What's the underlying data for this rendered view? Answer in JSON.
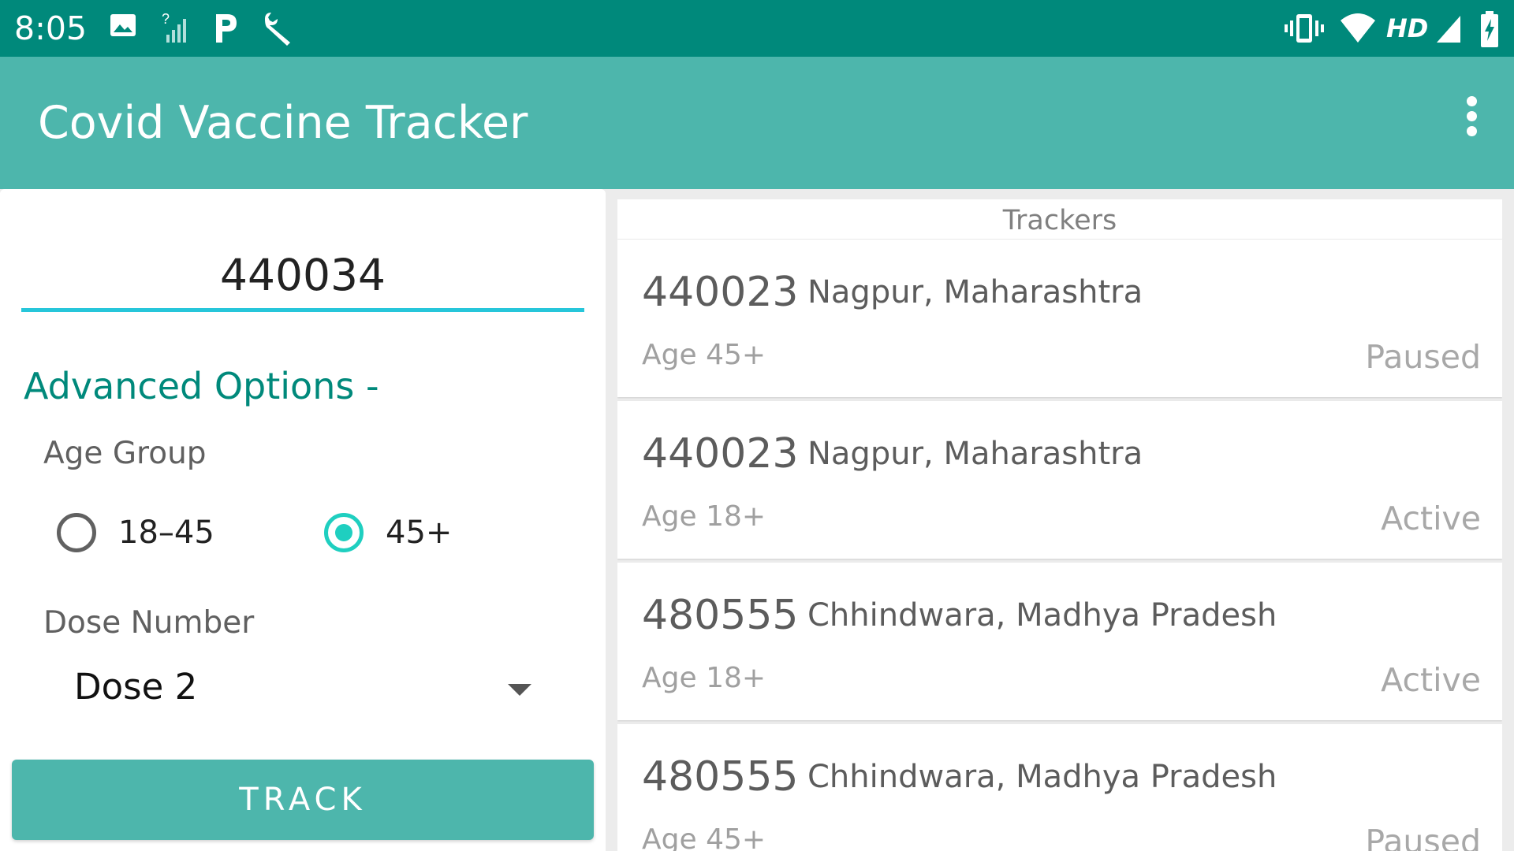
{
  "status_bar": {
    "time": "8:05",
    "left_icons": [
      "image-icon",
      "signal-unknown-icon",
      "parking-icon",
      "wrench-icon"
    ],
    "right_icons": [
      "vibrate-icon",
      "wifi-icon",
      "hd-icon",
      "cell-signal-icon",
      "battery-charging-icon"
    ],
    "hd_label": "HD"
  },
  "app_bar": {
    "title": "Covid Vaccine Tracker",
    "menu_icon": "more-vert-icon"
  },
  "form": {
    "pincode_value": "440034",
    "advanced_options_label": "Advanced Options -",
    "age_group_label": "Age Group",
    "age_options": [
      {
        "label": "18–45",
        "selected": false
      },
      {
        "label": "45+",
        "selected": true
      }
    ],
    "dose_number_label": "Dose Number",
    "dose_selected": "Dose 2",
    "track_button_label": "TRACK"
  },
  "trackers": {
    "header": "Trackers",
    "items": [
      {
        "pincode": "440023",
        "location": "Nagpur, Maharashtra",
        "age": "Age 45+",
        "status": "Paused"
      },
      {
        "pincode": "440023",
        "location": "Nagpur, Maharashtra",
        "age": "Age 18+",
        "status": "Active"
      },
      {
        "pincode": "480555",
        "location": "Chhindwara, Madhya Pradesh",
        "age": "Age 18+",
        "status": "Active"
      },
      {
        "pincode": "480555",
        "location": "Chhindwara, Madhya Pradesh",
        "age": "Age 45+",
        "status": "Paused"
      }
    ]
  },
  "colors": {
    "status_bar": "#00897b",
    "app_bar": "#4db6ac",
    "accent": "#1fcfc0",
    "heading_teal": "#00897b"
  }
}
